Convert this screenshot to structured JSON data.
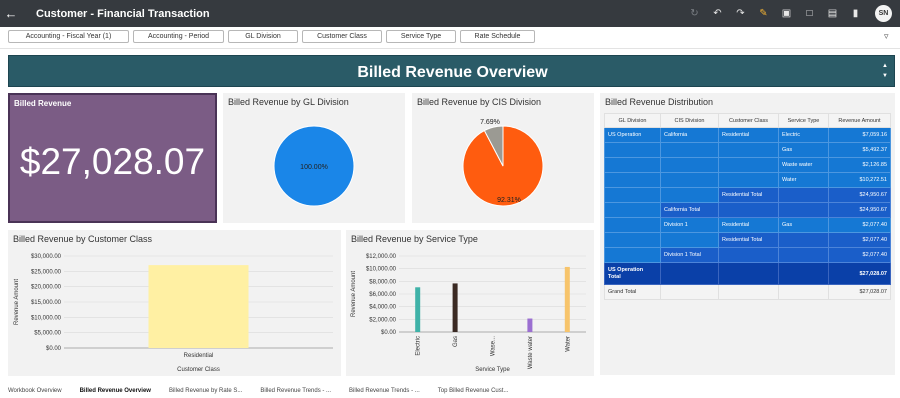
{
  "header": {
    "title": "Customer - Financial Transaction",
    "avatar_initials": "SN"
  },
  "filters": [
    "Accounting - Fiscal Year (1)",
    "Accounting - Period",
    "GL Division",
    "Customer Class",
    "Service Type",
    "Rate Schedule"
  ],
  "banner": {
    "title": "Billed Revenue Overview"
  },
  "kpi": {
    "title": "Billed Revenue",
    "value": "$27,028.07"
  },
  "charts": {
    "gl_division": {
      "title": "Billed Revenue by GL Division",
      "chart_data": {
        "type": "pie",
        "slices": [
          {
            "value": 100.0,
            "color": "#1a86e8"
          }
        ],
        "labels": [
          "100.00%"
        ]
      }
    },
    "cis_division": {
      "title": "Billed Revenue by CIS Division",
      "chart_data": {
        "type": "pie",
        "slices": [
          {
            "value": 92.31,
            "color": "#ff5c0f"
          },
          {
            "value": 7.69,
            "color": "#9b9a93"
          }
        ],
        "labels": [
          "92.31%",
          "7.69%"
        ]
      }
    },
    "customer_class": {
      "title": "Billed Revenue by Customer Class",
      "chart_data": {
        "type": "bar",
        "categories": [
          "Residential"
        ],
        "values": [
          27028.07
        ],
        "xlabel": "Customer Class",
        "ylabel": "Revenue Amount",
        "yticks": [
          "$0.00",
          "$5,000.00",
          "$10,000.00",
          "$15,000.00",
          "$20,000.00",
          "$25,000.00",
          "$30,000.00"
        ],
        "ylim": [
          0,
          30000
        ],
        "color": "#fff0a3"
      }
    },
    "service_type": {
      "title": "Billed Revenue by Service Type",
      "chart_data": {
        "type": "bar",
        "categories": [
          "Electric",
          "Gas",
          "Waste water",
          "Water",
          "Water"
        ],
        "category_labels": [
          "Electric",
          "Gas",
          "Wase...",
          "Waste water",
          "Water"
        ],
        "values": [
          7059.16,
          7670.35,
          0,
          2126.85,
          10272.51
        ],
        "colors": [
          "#3fb2a8",
          "#3b2a23",
          "#f7c46b",
          "#9b6fd1",
          "#f7c46b"
        ],
        "xlabel": "Service Type",
        "ylabel": "Revenue Amount",
        "yticks": [
          "$0.00",
          "$2,000.00",
          "$4,000.00",
          "$6,000.00",
          "$8,000.00",
          "$10,000.00",
          "$12,000.00"
        ],
        "ylim": [
          0,
          12000
        ]
      }
    }
  },
  "distribution": {
    "title": "Billed Revenue Distribution",
    "columns": [
      "GL Division",
      "CIS Division",
      "Customer Class",
      "Service Type",
      "Revenue Amount"
    ],
    "rows": [
      {
        "cells": [
          "US Operation",
          "California",
          "Residential",
          "Electric",
          "$7,059.16"
        ],
        "style": [
          "c1",
          "c1",
          "c1",
          "c1",
          "c1"
        ]
      },
      {
        "cells": [
          "",
          "",
          "",
          "Gas",
          "$5,492.37"
        ],
        "style": [
          "c1",
          "c1",
          "c1",
          "c1",
          "c1"
        ]
      },
      {
        "cells": [
          "",
          "",
          "",
          "Waste water",
          "$2,126.85"
        ],
        "style": [
          "c1",
          "c1",
          "c1",
          "c1",
          "c1"
        ]
      },
      {
        "cells": [
          "",
          "",
          "",
          "Water",
          "$10,272.51"
        ],
        "style": [
          "c1",
          "c1",
          "c1",
          "c1",
          "c1"
        ]
      },
      {
        "cells": [
          "",
          "",
          "Residential Total",
          "",
          "$24,950.67"
        ],
        "style": [
          "c1",
          "c1",
          "c2",
          "c2",
          "c2"
        ]
      },
      {
        "cells": [
          "",
          "California Total",
          "",
          "",
          "$24,950.67"
        ],
        "style": [
          "c1",
          "c2",
          "c2",
          "c2",
          "c2"
        ]
      },
      {
        "cells": [
          "",
          "Division 1",
          "Residential",
          "Gas",
          "$2,077.40"
        ],
        "style": [
          "c1",
          "c1",
          "c1",
          "c1",
          "c1"
        ]
      },
      {
        "cells": [
          "",
          "",
          "Residential Total",
          "",
          "$2,077.40"
        ],
        "style": [
          "c1",
          "c1",
          "c2",
          "c2",
          "c2"
        ]
      },
      {
        "cells": [
          "",
          "Division 1 Total",
          "",
          "",
          "$2,077.40"
        ],
        "style": [
          "c1",
          "c2",
          "c2",
          "c2",
          "c2"
        ]
      },
      {
        "cells": [
          "US Operation Total",
          "",
          "",
          "",
          "$27,028.07"
        ],
        "style": [
          "c3",
          "c3",
          "c3",
          "c3",
          "c3"
        ]
      },
      {
        "cells": [
          "Grand Total",
          "",
          "",
          "",
          "$27,028.07"
        ],
        "style": [
          "gt",
          "gt",
          "gt",
          "gt",
          "gt"
        ]
      }
    ]
  },
  "bottom_tabs": [
    "Workbook Overview",
    "Billed Revenue Overview",
    "Billed Revenue by Rate S...",
    "Billed Revenue Trends - ...",
    "Billed Revenue Trends - ...",
    "Top Billed Revenue Cust..."
  ],
  "active_tab": 1
}
